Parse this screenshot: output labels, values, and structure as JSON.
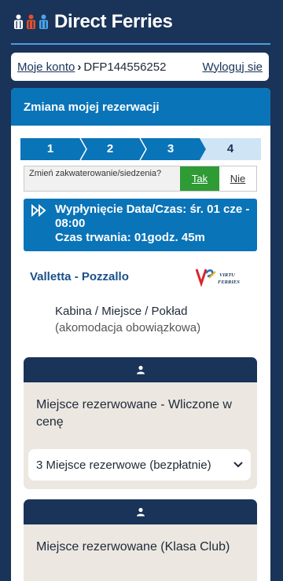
{
  "header": {
    "brand": "Direct Ferries",
    "icons": [
      "person-icon-white",
      "person-icon-orange",
      "person-icon-blue"
    ],
    "colors": {
      "background": "#1a3358",
      "accent_line": "#4a9fe0"
    }
  },
  "breadcrumb": {
    "account_link": "Moje konto",
    "separator": "›",
    "booking_ref": "DFP144556252",
    "logout_link": "Wyloguj sie"
  },
  "panel": {
    "title": "Zmiana mojej rezerwacji",
    "steps": [
      {
        "label": "1",
        "active": true
      },
      {
        "label": "2",
        "active": true
      },
      {
        "label": "3",
        "active": true
      },
      {
        "label": "4",
        "active": false
      }
    ],
    "question": {
      "text": "Zmień zakwaterowanie/siedzenia?",
      "yes": "Tak",
      "no": "Nie"
    },
    "departure": {
      "icon": "fast-forward-icon",
      "line1": "Wypłynięcie Data/Czas: śr. 01 cze - 08:00",
      "line2": "Czas trwania: 01godz. 45m"
    },
    "route": "Valletta - Pozzallo",
    "operator": {
      "name": "VIRTU FERRIES",
      "mark": "V"
    },
    "accommodation": {
      "title": "Kabina / Miejsce / Pokład",
      "subtitle": "(akomodacja obowiązkowa)"
    },
    "cards": [
      {
        "icon": "person-icon",
        "title": "Miejsce rezerwowane - Wliczone w cenę",
        "select_value": "3 Miejsce rezerwowe (bezpłatnie)"
      },
      {
        "icon": "person-icon",
        "title": "Miejsce rezerwowane (Klasa Club)"
      }
    ],
    "colors": {
      "head": "#0a74b8",
      "yes": "#2e9b35",
      "step_active": "#0a74b8",
      "step_inactive": "#cfe4f5"
    }
  }
}
